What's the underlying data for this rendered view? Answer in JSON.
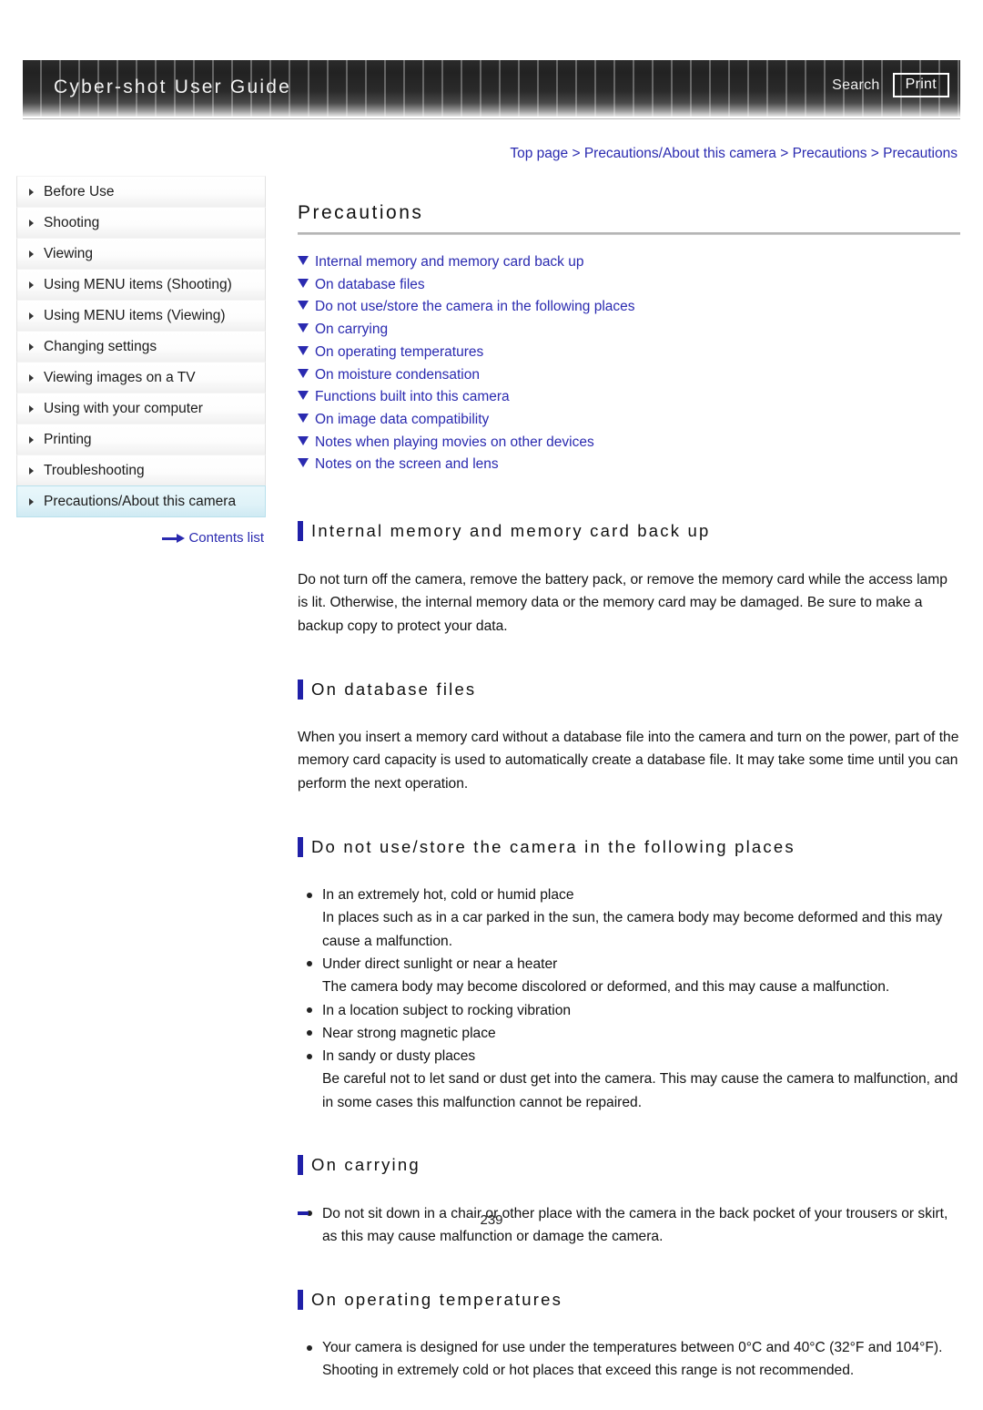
{
  "header": {
    "title": "Cyber-shot User Guide",
    "search_label": "Search",
    "print_label": "Print"
  },
  "breadcrumb": {
    "items": [
      "Top page",
      "Precautions/About this camera",
      "Precautions",
      "Precautions"
    ],
    "separator": ">"
  },
  "sidebar": {
    "items": [
      {
        "label": "Before Use",
        "selected": false
      },
      {
        "label": "Shooting",
        "selected": false
      },
      {
        "label": "Viewing",
        "selected": false
      },
      {
        "label": "Using MENU items (Shooting)",
        "selected": false
      },
      {
        "label": "Using MENU items (Viewing)",
        "selected": false
      },
      {
        "label": "Changing settings",
        "selected": false
      },
      {
        "label": "Viewing images on a TV",
        "selected": false
      },
      {
        "label": "Using with your computer",
        "selected": false
      },
      {
        "label": "Printing",
        "selected": false
      },
      {
        "label": "Troubleshooting",
        "selected": false
      },
      {
        "label": "Precautions/About this camera",
        "selected": true
      }
    ],
    "contents_list_label": "Contents list"
  },
  "main": {
    "page_title": "Precautions",
    "toc": [
      "Internal memory and memory card back up",
      "On database files",
      "Do not use/store the camera in the following places",
      "On carrying",
      "On operating temperatures",
      "On moisture condensation",
      "Functions built into this camera",
      "On image data compatibility",
      "Notes when playing movies on other devices",
      "Notes on the screen and lens"
    ],
    "sections": {
      "backup": {
        "title": "Internal memory and memory card back up",
        "body": "Do not turn off the camera, remove the battery pack, or remove the memory card while the access lamp is lit. Otherwise, the internal memory data or the memory card may be damaged. Be sure to make a backup copy to protect your data."
      },
      "database": {
        "title": "On database files",
        "body": "When you insert a memory card without a database file into the camera and turn on the power, part of the memory card capacity is used to automatically create a database file. It may take some time until you can perform the next operation."
      },
      "places": {
        "title": "Do not use/store the camera in the following places",
        "b1": "In an extremely hot, cold or humid place",
        "b1sub": "In places such as in a car parked in the sun, the camera body may become deformed and this may cause a malfunction.",
        "b2": "Under direct sunlight or near a heater",
        "b2sub": "The camera body may become discolored or deformed, and this may cause a malfunction.",
        "b3": "In a location subject to rocking vibration",
        "b4": "Near strong magnetic place",
        "b5": "In sandy or dusty places",
        "b5sub": "Be careful not to let sand or dust get into the camera. This may cause the camera to malfunction, and in some cases this malfunction cannot be repaired."
      },
      "carrying": {
        "title": "On carrying",
        "b1": "Do not sit down in a chair or other place with the camera in the back pocket of your trousers or skirt, as this may cause malfunction or damage the camera."
      },
      "temperatures": {
        "title": "On operating temperatures",
        "b1": "Your camera is designed for use under the temperatures between 0°C and 40°C (32°F and 104°F). Shooting in extremely cold or hot places that exceed this range is not recommended."
      }
    }
  },
  "footer": {
    "page_number": "239"
  },
  "colors": {
    "link": "#2a2ab0",
    "accent_bar": "#2020a8",
    "selected_row": "#dff2f8",
    "header_dark": "#222222"
  }
}
